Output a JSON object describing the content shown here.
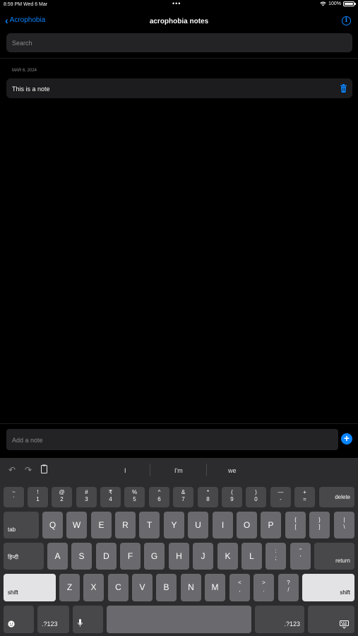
{
  "status": {
    "time": "8:59 PM",
    "date": "Wed 6 Mar",
    "dots": "•••",
    "battery": "100%"
  },
  "nav": {
    "back_label": "Acrophobia",
    "title": "acrophobia notes"
  },
  "search": {
    "placeholder": "Search"
  },
  "notes": {
    "section_date": "MAR 6, 2024",
    "items": [
      {
        "text": "This is a note"
      }
    ]
  },
  "composer": {
    "placeholder": "Add a note"
  },
  "keyboard": {
    "suggestions": [
      "I",
      "I'm",
      "we"
    ],
    "row1": [
      {
        "top": "~",
        "bot": "`"
      },
      {
        "top": "!",
        "bot": "1"
      },
      {
        "top": "@",
        "bot": "2"
      },
      {
        "top": "#",
        "bot": "3"
      },
      {
        "top": "₹",
        "bot": "4"
      },
      {
        "top": "%",
        "bot": "5"
      },
      {
        "top": "^",
        "bot": "6"
      },
      {
        "top": "&",
        "bot": "7"
      },
      {
        "top": "*",
        "bot": "8"
      },
      {
        "top": "(",
        "bot": "9"
      },
      {
        "top": ")",
        "bot": "0"
      },
      {
        "top": "—",
        "bot": "-"
      },
      {
        "top": "+",
        "bot": "="
      }
    ],
    "delete": "delete",
    "tab": "tab",
    "row2": [
      "Q",
      "W",
      "E",
      "R",
      "T",
      "Y",
      "U",
      "I",
      "O",
      "P"
    ],
    "row2_sym": [
      {
        "top": "{",
        "bot": "["
      },
      {
        "top": "}",
        "bot": "]"
      },
      {
        "top": "|",
        "bot": "\\"
      }
    ],
    "lang": "हिन्दी",
    "row3": [
      "A",
      "S",
      "D",
      "F",
      "G",
      "H",
      "J",
      "K",
      "L"
    ],
    "row3_sym": [
      {
        "top": ":",
        "bot": ";"
      },
      {
        "top": "\"",
        "bot": "'"
      }
    ],
    "return": "return",
    "shift": "shift",
    "row4": [
      "Z",
      "X",
      "C",
      "V",
      "B",
      "N",
      "M"
    ],
    "row4_sym": [
      {
        "top": "<",
        "bot": ","
      },
      {
        "top": ">",
        "bot": "."
      },
      {
        "top": "?",
        "bot": "/"
      }
    ],
    "numbers": ".?123"
  },
  "colors": {
    "accent": "#0a84ff",
    "background": "#000000",
    "key": "#6a6a6e",
    "key_dark": "#48484a"
  }
}
